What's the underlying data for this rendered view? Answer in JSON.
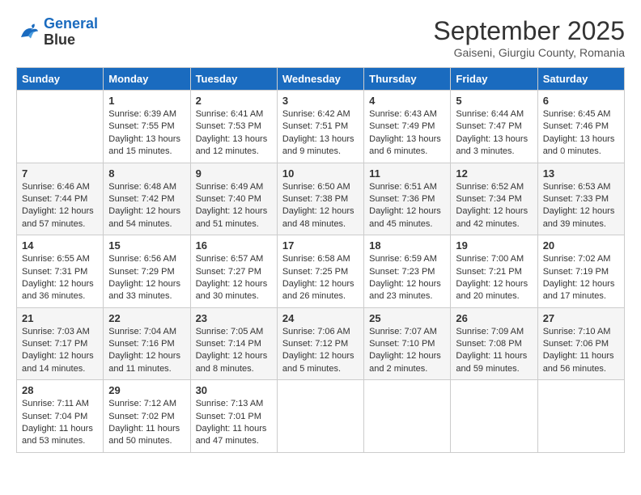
{
  "logo": {
    "line1": "General",
    "line2": "Blue"
  },
  "title": "September 2025",
  "subtitle": "Gaiseni, Giurgiu County, Romania",
  "weekdays": [
    "Sunday",
    "Monday",
    "Tuesday",
    "Wednesday",
    "Thursday",
    "Friday",
    "Saturday"
  ],
  "weeks": [
    [
      {
        "day": "",
        "sunrise": "",
        "sunset": "",
        "daylight": ""
      },
      {
        "day": "1",
        "sunrise": "Sunrise: 6:39 AM",
        "sunset": "Sunset: 7:55 PM",
        "daylight": "Daylight: 13 hours and 15 minutes."
      },
      {
        "day": "2",
        "sunrise": "Sunrise: 6:41 AM",
        "sunset": "Sunset: 7:53 PM",
        "daylight": "Daylight: 13 hours and 12 minutes."
      },
      {
        "day": "3",
        "sunrise": "Sunrise: 6:42 AM",
        "sunset": "Sunset: 7:51 PM",
        "daylight": "Daylight: 13 hours and 9 minutes."
      },
      {
        "day": "4",
        "sunrise": "Sunrise: 6:43 AM",
        "sunset": "Sunset: 7:49 PM",
        "daylight": "Daylight: 13 hours and 6 minutes."
      },
      {
        "day": "5",
        "sunrise": "Sunrise: 6:44 AM",
        "sunset": "Sunset: 7:47 PM",
        "daylight": "Daylight: 13 hours and 3 minutes."
      },
      {
        "day": "6",
        "sunrise": "Sunrise: 6:45 AM",
        "sunset": "Sunset: 7:46 PM",
        "daylight": "Daylight: 13 hours and 0 minutes."
      }
    ],
    [
      {
        "day": "7",
        "sunrise": "Sunrise: 6:46 AM",
        "sunset": "Sunset: 7:44 PM",
        "daylight": "Daylight: 12 hours and 57 minutes."
      },
      {
        "day": "8",
        "sunrise": "Sunrise: 6:48 AM",
        "sunset": "Sunset: 7:42 PM",
        "daylight": "Daylight: 12 hours and 54 minutes."
      },
      {
        "day": "9",
        "sunrise": "Sunrise: 6:49 AM",
        "sunset": "Sunset: 7:40 PM",
        "daylight": "Daylight: 12 hours and 51 minutes."
      },
      {
        "day": "10",
        "sunrise": "Sunrise: 6:50 AM",
        "sunset": "Sunset: 7:38 PM",
        "daylight": "Daylight: 12 hours and 48 minutes."
      },
      {
        "day": "11",
        "sunrise": "Sunrise: 6:51 AM",
        "sunset": "Sunset: 7:36 PM",
        "daylight": "Daylight: 12 hours and 45 minutes."
      },
      {
        "day": "12",
        "sunrise": "Sunrise: 6:52 AM",
        "sunset": "Sunset: 7:34 PM",
        "daylight": "Daylight: 12 hours and 42 minutes."
      },
      {
        "day": "13",
        "sunrise": "Sunrise: 6:53 AM",
        "sunset": "Sunset: 7:33 PM",
        "daylight": "Daylight: 12 hours and 39 minutes."
      }
    ],
    [
      {
        "day": "14",
        "sunrise": "Sunrise: 6:55 AM",
        "sunset": "Sunset: 7:31 PM",
        "daylight": "Daylight: 12 hours and 36 minutes."
      },
      {
        "day": "15",
        "sunrise": "Sunrise: 6:56 AM",
        "sunset": "Sunset: 7:29 PM",
        "daylight": "Daylight: 12 hours and 33 minutes."
      },
      {
        "day": "16",
        "sunrise": "Sunrise: 6:57 AM",
        "sunset": "Sunset: 7:27 PM",
        "daylight": "Daylight: 12 hours and 30 minutes."
      },
      {
        "day": "17",
        "sunrise": "Sunrise: 6:58 AM",
        "sunset": "Sunset: 7:25 PM",
        "daylight": "Daylight: 12 hours and 26 minutes."
      },
      {
        "day": "18",
        "sunrise": "Sunrise: 6:59 AM",
        "sunset": "Sunset: 7:23 PM",
        "daylight": "Daylight: 12 hours and 23 minutes."
      },
      {
        "day": "19",
        "sunrise": "Sunrise: 7:00 AM",
        "sunset": "Sunset: 7:21 PM",
        "daylight": "Daylight: 12 hours and 20 minutes."
      },
      {
        "day": "20",
        "sunrise": "Sunrise: 7:02 AM",
        "sunset": "Sunset: 7:19 PM",
        "daylight": "Daylight: 12 hours and 17 minutes."
      }
    ],
    [
      {
        "day": "21",
        "sunrise": "Sunrise: 7:03 AM",
        "sunset": "Sunset: 7:17 PM",
        "daylight": "Daylight: 12 hours and 14 minutes."
      },
      {
        "day": "22",
        "sunrise": "Sunrise: 7:04 AM",
        "sunset": "Sunset: 7:16 PM",
        "daylight": "Daylight: 12 hours and 11 minutes."
      },
      {
        "day": "23",
        "sunrise": "Sunrise: 7:05 AM",
        "sunset": "Sunset: 7:14 PM",
        "daylight": "Daylight: 12 hours and 8 minutes."
      },
      {
        "day": "24",
        "sunrise": "Sunrise: 7:06 AM",
        "sunset": "Sunset: 7:12 PM",
        "daylight": "Daylight: 12 hours and 5 minutes."
      },
      {
        "day": "25",
        "sunrise": "Sunrise: 7:07 AM",
        "sunset": "Sunset: 7:10 PM",
        "daylight": "Daylight: 12 hours and 2 minutes."
      },
      {
        "day": "26",
        "sunrise": "Sunrise: 7:09 AM",
        "sunset": "Sunset: 7:08 PM",
        "daylight": "Daylight: 11 hours and 59 minutes."
      },
      {
        "day": "27",
        "sunrise": "Sunrise: 7:10 AM",
        "sunset": "Sunset: 7:06 PM",
        "daylight": "Daylight: 11 hours and 56 minutes."
      }
    ],
    [
      {
        "day": "28",
        "sunrise": "Sunrise: 7:11 AM",
        "sunset": "Sunset: 7:04 PM",
        "daylight": "Daylight: 11 hours and 53 minutes."
      },
      {
        "day": "29",
        "sunrise": "Sunrise: 7:12 AM",
        "sunset": "Sunset: 7:02 PM",
        "daylight": "Daylight: 11 hours and 50 minutes."
      },
      {
        "day": "30",
        "sunrise": "Sunrise: 7:13 AM",
        "sunset": "Sunset: 7:01 PM",
        "daylight": "Daylight: 11 hours and 47 minutes."
      },
      {
        "day": "",
        "sunrise": "",
        "sunset": "",
        "daylight": ""
      },
      {
        "day": "",
        "sunrise": "",
        "sunset": "",
        "daylight": ""
      },
      {
        "day": "",
        "sunrise": "",
        "sunset": "",
        "daylight": ""
      },
      {
        "day": "",
        "sunrise": "",
        "sunset": "",
        "daylight": ""
      }
    ]
  ]
}
